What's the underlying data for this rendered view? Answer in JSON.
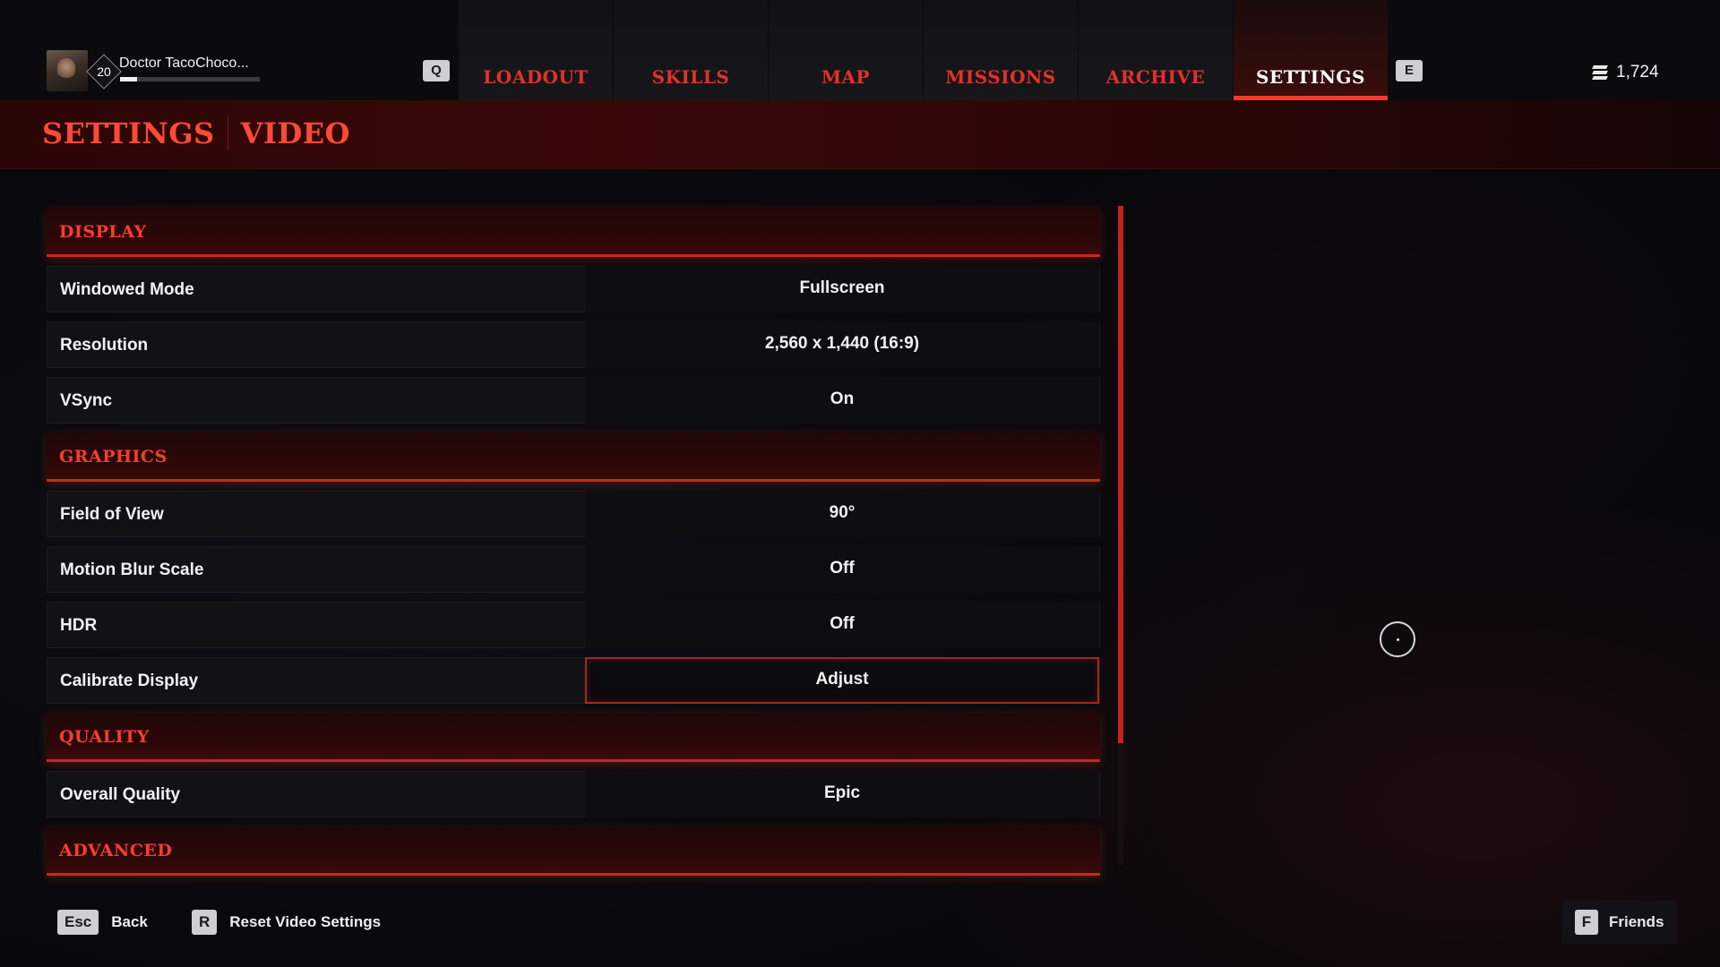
{
  "player": {
    "level": "20",
    "name": "Doctor TacoChoco...",
    "xp_fraction": 0.12
  },
  "nav": {
    "prev_key": "Q",
    "next_key": "E",
    "tabs": [
      {
        "label": "LOADOUT"
      },
      {
        "label": "SKILLS"
      },
      {
        "label": "MAP"
      },
      {
        "label": "MISSIONS"
      },
      {
        "label": "ARCHIVE"
      },
      {
        "label": "SETTINGS",
        "active": true
      }
    ]
  },
  "currency": {
    "amount": "1,724",
    "icon": "currency-icon"
  },
  "page": {
    "title": "SETTINGS",
    "subtitle": "VIDEO"
  },
  "sections": {
    "display": "DISPLAY",
    "graphics": "GRAPHICS",
    "quality": "QUALITY",
    "advanced": "ADVANCED"
  },
  "settings": {
    "windowed_mode": {
      "label": "Windowed Mode",
      "value": "Fullscreen"
    },
    "resolution": {
      "label": "Resolution",
      "value": "2,560 x 1,440 (16:9)"
    },
    "vsync": {
      "label": "VSync",
      "value": "On"
    },
    "fov": {
      "label": "Field of View",
      "value": "90°"
    },
    "motion_blur": {
      "label": "Motion Blur Scale",
      "value": "Off"
    },
    "hdr": {
      "label": "HDR",
      "value": "Off"
    },
    "calibrate": {
      "label": "Calibrate Display",
      "value": "Adjust"
    },
    "overall_quality": {
      "label": "Overall Quality",
      "value": "Epic"
    }
  },
  "footer": {
    "back_key": "Esc",
    "back_label": "Back",
    "reset_key": "R",
    "reset_label": "Reset Video Settings",
    "friends_key": "F",
    "friends_label": "Friends"
  },
  "colors": {
    "accent": "#f03c2a",
    "section_text": "#ff3b2e",
    "background": "#08080b"
  }
}
